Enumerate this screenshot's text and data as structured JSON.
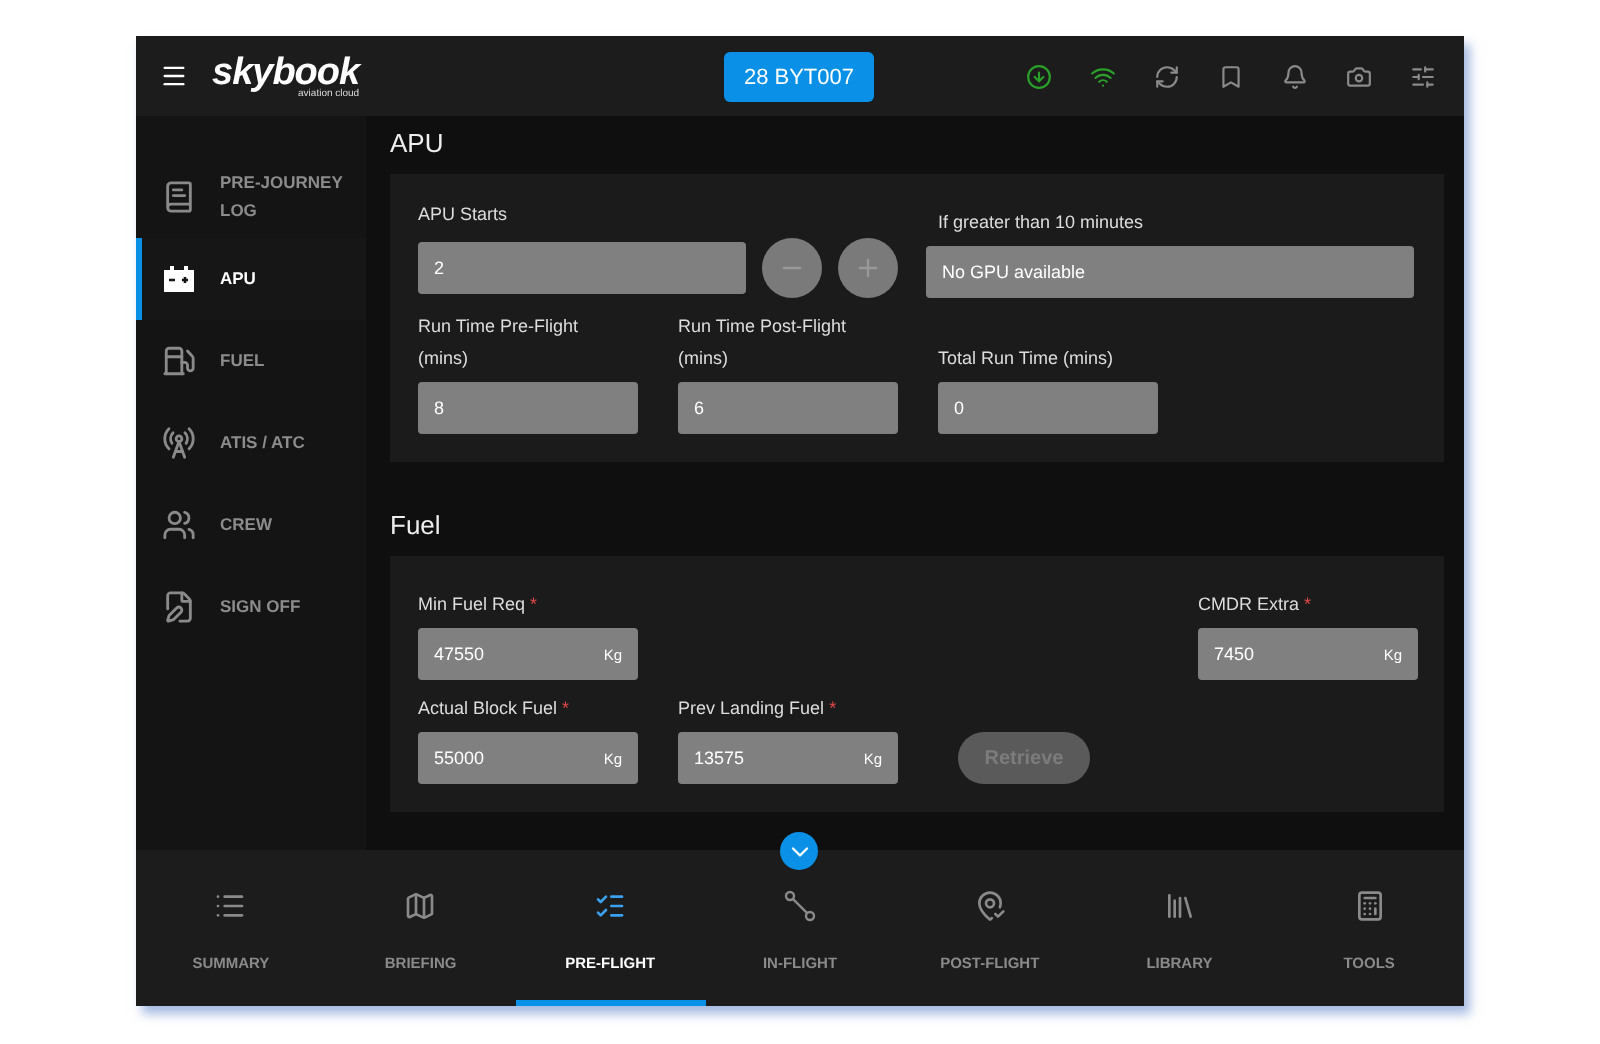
{
  "topbar": {
    "logo": "skybook",
    "logo_sub": "aviation cloud",
    "flight": "28 BYT007",
    "status_icons": [
      {
        "kind": "download",
        "active": true
      },
      {
        "kind": "wifi",
        "active": true
      },
      {
        "kind": "sync",
        "active": false
      },
      {
        "kind": "bookmark",
        "active": false
      },
      {
        "kind": "bell",
        "active": false
      },
      {
        "kind": "camera",
        "active": false
      },
      {
        "kind": "sliders",
        "active": false
      }
    ]
  },
  "sidebar": {
    "items": [
      {
        "kind": "log",
        "label": "PRE-JOURNEY LOG",
        "selected": false
      },
      {
        "kind": "apu",
        "label": "APU",
        "selected": true
      },
      {
        "kind": "fuel",
        "label": "FUEL",
        "selected": false
      },
      {
        "kind": "atis",
        "label": "ATIS / ATC",
        "selected": false
      },
      {
        "kind": "crew",
        "label": "CREW",
        "selected": false
      },
      {
        "kind": "sign",
        "label": "SIGN OFF",
        "selected": false
      }
    ]
  },
  "sections": [
    {
      "title": "APU",
      "fields": [
        {
          "kind": "counter",
          "label": "APU Starts",
          "value": "2"
        },
        {
          "kind": "text",
          "label": "If greater than 10 minutes",
          "value": "No GPU available"
        },
        {
          "kind": "number",
          "label": "Run Time Pre-Flight (mins)",
          "value": "8"
        },
        {
          "kind": "number",
          "label": "Run Time Post-Flight (mins)",
          "value": "6"
        },
        {
          "kind": "number",
          "label": "Total Run Time (mins)",
          "value": "0"
        }
      ]
    },
    {
      "title": "Fuel",
      "fields": [
        {
          "kind": "measure",
          "label": "Min Fuel Req",
          "required_mark": "*",
          "value": "47550",
          "unit": "Kg"
        },
        {
          "kind": "gap"
        },
        {
          "kind": "gap"
        },
        {
          "kind": "measure",
          "label": "CMDR Extra",
          "required_mark": "*",
          "value": "7450",
          "unit": "Kg"
        },
        {
          "kind": "measure",
          "label": "Actual Block Fuel",
          "required_mark": "*",
          "value": "55000",
          "unit": "Kg"
        },
        {
          "kind": "measure",
          "label": "Prev Landing Fuel",
          "required_mark": "*",
          "value": "13575",
          "unit": "Kg"
        },
        {
          "kind": "button",
          "label": "Retrieve",
          "disabled": true
        }
      ]
    }
  ],
  "bottom_tabs": [
    {
      "kind": "summary",
      "label": "SUMMARY",
      "selected": false
    },
    {
      "kind": "briefing",
      "label": "BRIEFING",
      "selected": false
    },
    {
      "kind": "preflight",
      "label": "PRE-FLIGHT",
      "selected": true
    },
    {
      "kind": "inflight",
      "label": "IN-FLIGHT",
      "selected": false
    },
    {
      "kind": "postflight",
      "label": "POST-FLIGHT",
      "selected": false
    },
    {
      "kind": "library",
      "label": "LIBRARY",
      "selected": false
    },
    {
      "kind": "tools",
      "label": "TOOLS",
      "selected": false
    }
  ]
}
